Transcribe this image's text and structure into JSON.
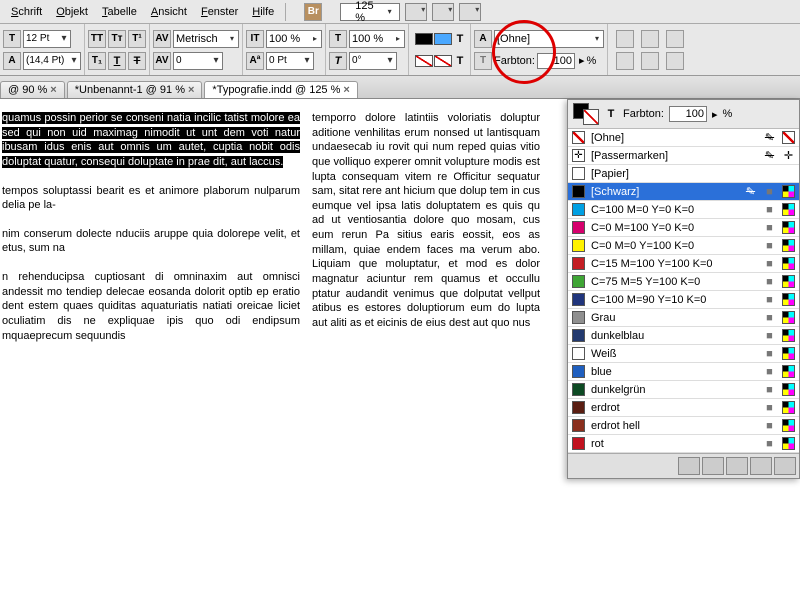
{
  "menu": {
    "items": [
      "Schrift",
      "Objekt",
      "Tabelle",
      "Ansicht",
      "Fenster",
      "Hilfe"
    ],
    "hot": [
      0,
      0,
      0,
      0,
      0,
      0
    ],
    "br": "Br",
    "zoom": "125 %"
  },
  "toolbar": {
    "fontSize": "12 Pt",
    "leading": "(14,4 Pt)",
    "kerning": "Metrisch",
    "tracking": "0",
    "hscale": "100 %",
    "vscale": "100 %",
    "baseline": "0 Pt",
    "skew": "0°",
    "charStyle": "[Ohne]",
    "tintLabel": "Farbton:",
    "tintVal": "100",
    "tintUnit": "%"
  },
  "tabs": [
    {
      "label": "@ 90 %",
      "close": "×"
    },
    {
      "label": "*Unbenannt-1 @ 91 %",
      "close": "×"
    },
    {
      "label": "*Typografie.indd @ 125 %",
      "close": "×"
    }
  ],
  "text": {
    "selP": "quamus possin perior se conseni natia incilic tatist molore ea sed qui non uid maximag nimodit ut unt dem voti natur ibusam idus enis aut omnis um autet, cuptia nobit odis doluptat quatur, consequi doluptate in prae dit, aut laccus.",
    "p2": "tempos soluptassi bearit es et animore plaborum nulparum delia pe la-",
    "p3": "nim conserum dolecte nduciis aruppe quia dolorepe velit, et etus, sum na",
    "p4": "n rehenducipsa cuptiosant di omninaxim aut omnisci andessit mo tendiep delecae eosanda dolorit optib ep eratio dent estem quaes quiditas aquaturiatis natiati oreicae liciet oculiatim dis ne expliquae ipis quo odi endipsum mquaeprecum sequundis",
    "p5": "temporro dolore latintiis voloriatis doluptur aditione venhilitas erum nonsed ut lantisquam undaesecab iu rovit qui num reped quias vitio que volliquo experer omnit volupture modis est lupta consequam vitem re Officitur sequatur sam, sitat rere ant hicium que dolup tem in cus eumque vel ipsa latis doluptatem es quis qu ad ut ventiosantia dolore quo mosam, cus eum rerun Pa sitius earis eossit, eos as millam, quiae endem faces ma verum abo. Liquiam que moluptatur, et mod es dolor magnatur aciuntur rem quamus et occullu ptatur audandit venimus que dolputat vellput atibus es estores doluptiorum eum do lupta aut aliti as et eicinis de eius dest aut quo nus"
  },
  "swatches": {
    "tintLabel": "Farbton:",
    "tintVal": "100",
    "unit": "%",
    "rows": [
      {
        "name": "[Ohne]",
        "chip": "none",
        "lock": true,
        "none": true
      },
      {
        "name": "[Passermarken]",
        "chip": "reg",
        "lock": true,
        "reg": true
      },
      {
        "name": "[Papier]",
        "chip": "#ffffff"
      },
      {
        "name": "[Schwarz]",
        "chip": "#000000",
        "lock": true,
        "cmyk": true,
        "selected": true
      },
      {
        "name": "C=100 M=0 Y=0 K=0",
        "chip": "#00a0e3",
        "cmyk": true
      },
      {
        "name": "C=0 M=100 Y=0 K=0",
        "chip": "#d6006d",
        "cmyk": true
      },
      {
        "name": "C=0 M=0 Y=100 K=0",
        "chip": "#fff200",
        "cmyk": true
      },
      {
        "name": "C=15 M=100 Y=100 K=0",
        "chip": "#c41e24",
        "cmyk": true
      },
      {
        "name": "C=75 M=5 Y=100 K=0",
        "chip": "#3fa535",
        "cmyk": true
      },
      {
        "name": "C=100 M=90 Y=10 K=0",
        "chip": "#20357c",
        "cmyk": true
      },
      {
        "name": "Grau",
        "chip": "#8f8f8f",
        "cmyk": true
      },
      {
        "name": "dunkelblau",
        "chip": "#233a6f",
        "cmyk": true
      },
      {
        "name": "Weiß",
        "chip": "#ffffff",
        "cmyk": true
      },
      {
        "name": "blue",
        "chip": "#1f5fbf",
        "cmyk": true
      },
      {
        "name": "dunkelgrün",
        "chip": "#0d4a23",
        "cmyk": true
      },
      {
        "name": "erdrot",
        "chip": "#5a1e12",
        "cmyk": true
      },
      {
        "name": "erdrot hell",
        "chip": "#8a2f1d",
        "cmyk": true
      },
      {
        "name": "rot",
        "chip": "#c1121f",
        "cmyk": true
      }
    ]
  }
}
